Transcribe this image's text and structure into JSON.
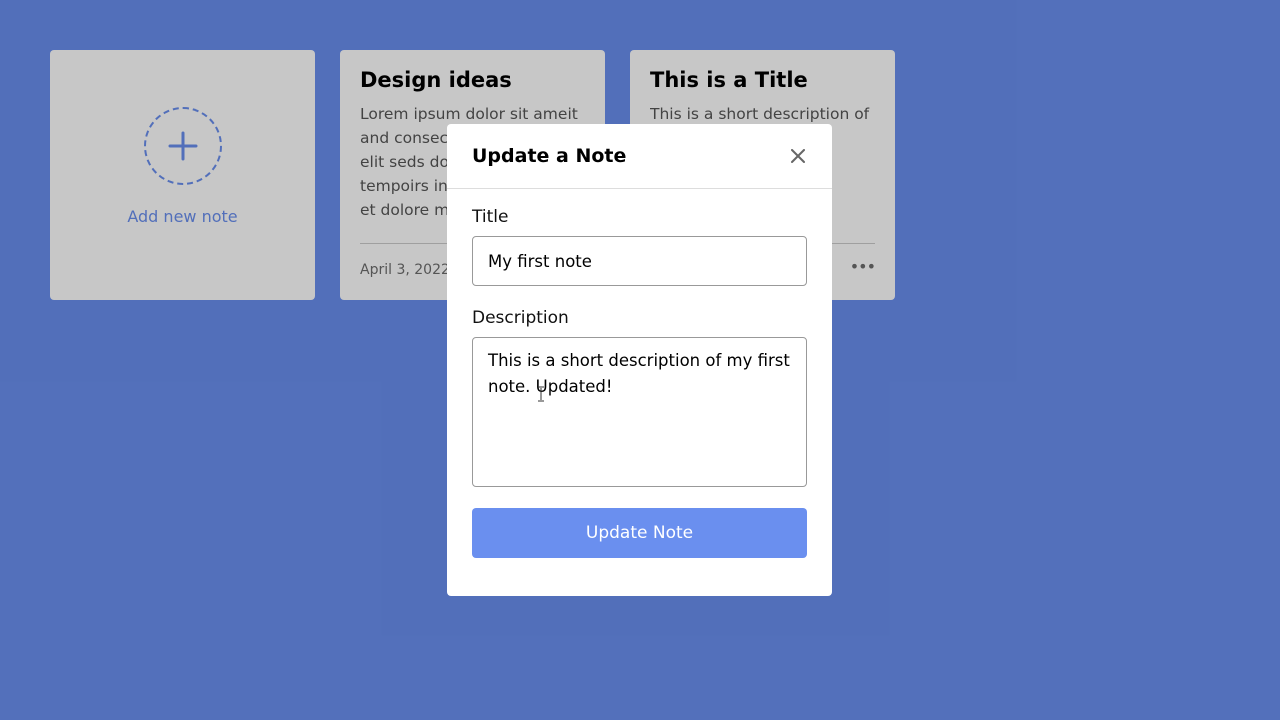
{
  "colors": {
    "background": "#6a8fef",
    "accent": "#6a8fef",
    "card": "#ffffff",
    "overlay": "rgba(0,0,0,0.22)"
  },
  "add_card": {
    "icon": "plus-icon",
    "label": "Add new note"
  },
  "notes": [
    {
      "title": "Design ideas",
      "description": "Lorem ipsum dolor sit ameit and consectetur adipiscing elit seds do eiusmod tempoirs incididunt ut labore et dolore magna aliqua.",
      "date": "April 3, 2022",
      "menu_icon": "ellipsis-icon"
    },
    {
      "title": "This is a Title",
      "description": "This is a short description of my first note.",
      "date": "",
      "menu_icon": "ellipsis-icon"
    }
  ],
  "popup": {
    "title": "Update a Note",
    "close_icon": "close-icon",
    "title_label": "Title",
    "title_value": "My first note",
    "description_label": "Description",
    "description_value": "This is a short description of my first note. Updated!",
    "submit_label": "Update Note"
  }
}
